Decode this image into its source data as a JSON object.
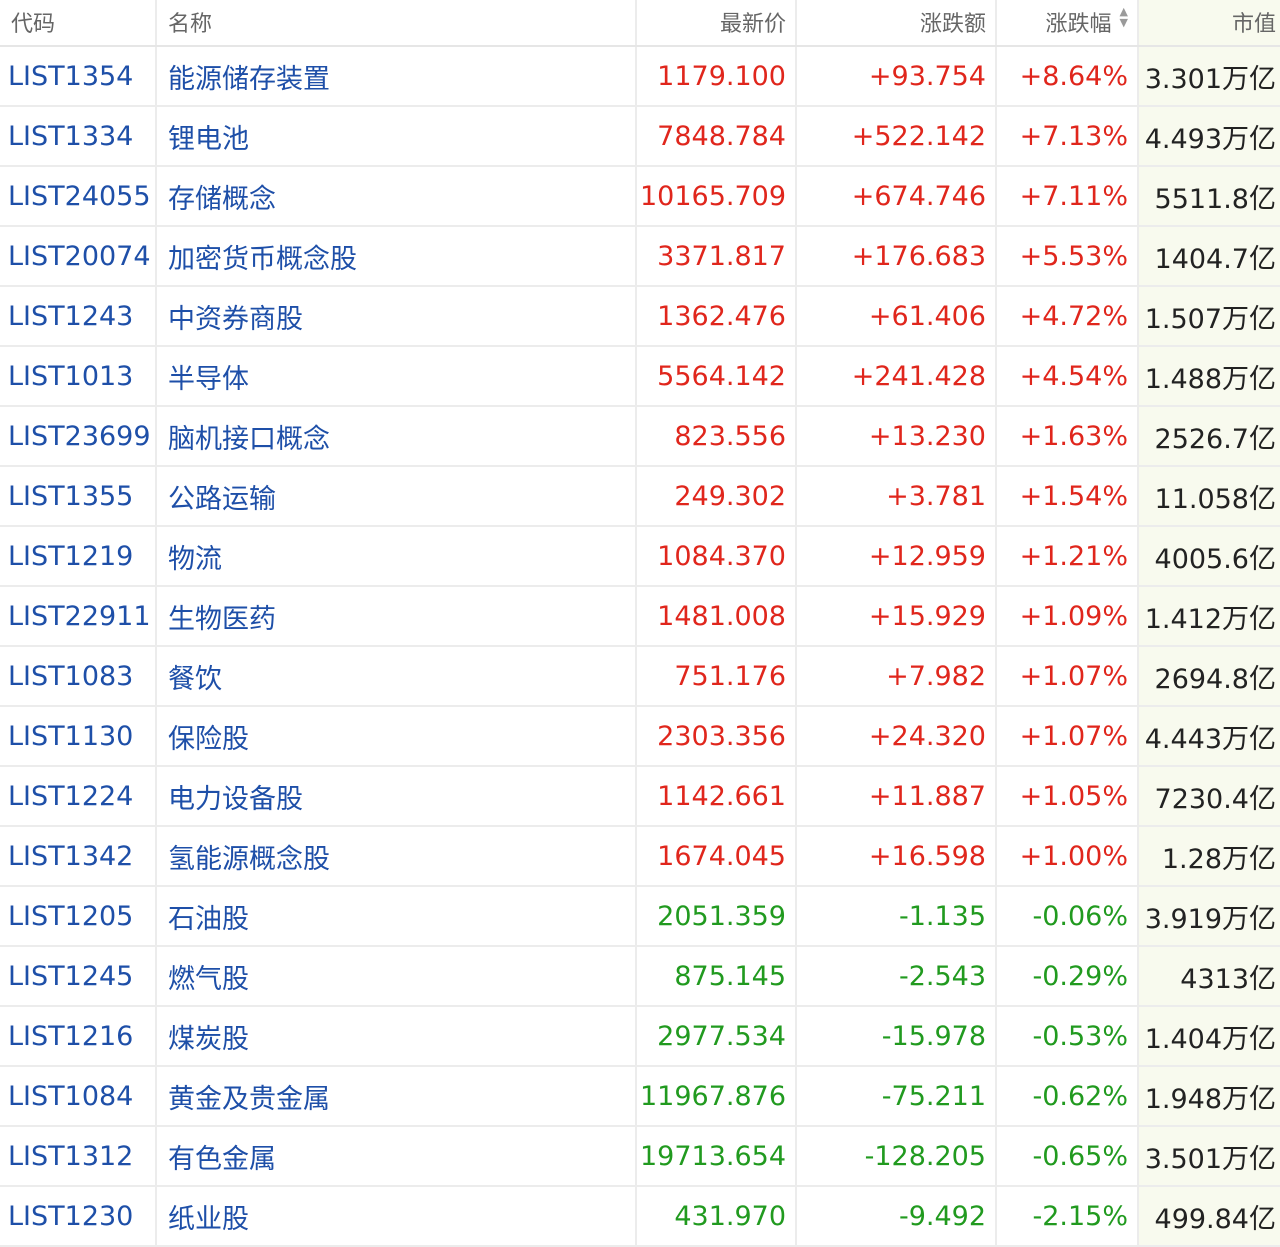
{
  "colors": {
    "up": "#e0261c",
    "down": "#219a1f",
    "code": "#1e4fa8",
    "header": "#666666",
    "cap_bg": "#f8faee"
  },
  "header": {
    "code": "代码",
    "name": "名称",
    "price": "最新价",
    "change": "涨跌额",
    "pct": "涨跌幅",
    "cap": "市值",
    "sort_icons": [
      "sort-up-icon",
      "sort-down-icon"
    ]
  },
  "rows": [
    {
      "code": "LIST1354",
      "name": "能源储存装置",
      "price": "1179.100",
      "change": "+93.754",
      "pct": "+8.64%",
      "cap": "3.301万亿",
      "dir": "up"
    },
    {
      "code": "LIST1334",
      "name": "锂电池",
      "price": "7848.784",
      "change": "+522.142",
      "pct": "+7.13%",
      "cap": "4.493万亿",
      "dir": "up"
    },
    {
      "code": "LIST24055",
      "name": "存储概念",
      "price": "10165.709",
      "change": "+674.746",
      "pct": "+7.11%",
      "cap": "5511.8亿",
      "dir": "up"
    },
    {
      "code": "LIST20074",
      "name": "加密货币概念股",
      "price": "3371.817",
      "change": "+176.683",
      "pct": "+5.53%",
      "cap": "1404.7亿",
      "dir": "up"
    },
    {
      "code": "LIST1243",
      "name": "中资券商股",
      "price": "1362.476",
      "change": "+61.406",
      "pct": "+4.72%",
      "cap": "1.507万亿",
      "dir": "up"
    },
    {
      "code": "LIST1013",
      "name": "半导体",
      "price": "5564.142",
      "change": "+241.428",
      "pct": "+4.54%",
      "cap": "1.488万亿",
      "dir": "up"
    },
    {
      "code": "LIST23699",
      "name": "脑机接口概念",
      "price": "823.556",
      "change": "+13.230",
      "pct": "+1.63%",
      "cap": "2526.7亿",
      "dir": "up"
    },
    {
      "code": "LIST1355",
      "name": "公路运输",
      "price": "249.302",
      "change": "+3.781",
      "pct": "+1.54%",
      "cap": "11.058亿",
      "dir": "up"
    },
    {
      "code": "LIST1219",
      "name": "物流",
      "price": "1084.370",
      "change": "+12.959",
      "pct": "+1.21%",
      "cap": "4005.6亿",
      "dir": "up"
    },
    {
      "code": "LIST22911",
      "name": "生物医药",
      "price": "1481.008",
      "change": "+15.929",
      "pct": "+1.09%",
      "cap": "1.412万亿",
      "dir": "up"
    },
    {
      "code": "LIST1083",
      "name": "餐饮",
      "price": "751.176",
      "change": "+7.982",
      "pct": "+1.07%",
      "cap": "2694.8亿",
      "dir": "up"
    },
    {
      "code": "LIST1130",
      "name": "保险股",
      "price": "2303.356",
      "change": "+24.320",
      "pct": "+1.07%",
      "cap": "4.443万亿",
      "dir": "up"
    },
    {
      "code": "LIST1224",
      "name": "电力设备股",
      "price": "1142.661",
      "change": "+11.887",
      "pct": "+1.05%",
      "cap": "7230.4亿",
      "dir": "up"
    },
    {
      "code": "LIST1342",
      "name": "氢能源概念股",
      "price": "1674.045",
      "change": "+16.598",
      "pct": "+1.00%",
      "cap": "1.28万亿",
      "dir": "up"
    },
    {
      "code": "LIST1205",
      "name": "石油股",
      "price": "2051.359",
      "change": "-1.135",
      "pct": "-0.06%",
      "cap": "3.919万亿",
      "dir": "down"
    },
    {
      "code": "LIST1245",
      "name": "燃气股",
      "price": "875.145",
      "change": "-2.543",
      "pct": "-0.29%",
      "cap": "4313亿",
      "dir": "down"
    },
    {
      "code": "LIST1216",
      "name": "煤炭股",
      "price": "2977.534",
      "change": "-15.978",
      "pct": "-0.53%",
      "cap": "1.404万亿",
      "dir": "down"
    },
    {
      "code": "LIST1084",
      "name": "黄金及贵金属",
      "price": "11967.876",
      "change": "-75.211",
      "pct": "-0.62%",
      "cap": "1.948万亿",
      "dir": "down"
    },
    {
      "code": "LIST1312",
      "name": "有色金属",
      "price": "19713.654",
      "change": "-128.205",
      "pct": "-0.65%",
      "cap": "3.501万亿",
      "dir": "down"
    },
    {
      "code": "LIST1230",
      "name": "纸业股",
      "price": "431.970",
      "change": "-9.492",
      "pct": "-2.15%",
      "cap": "499.84亿",
      "dir": "down"
    }
  ]
}
